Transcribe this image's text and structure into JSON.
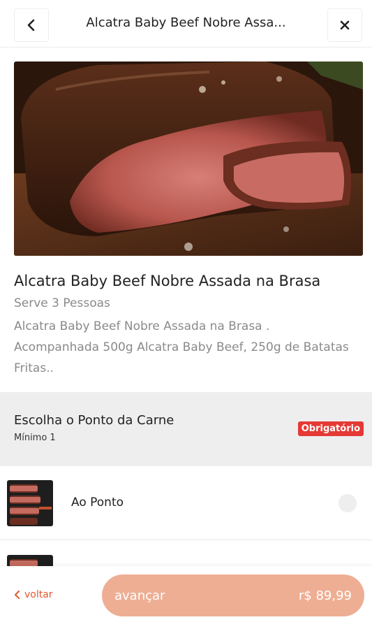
{
  "header": {
    "title": "Alcatra Baby Beef Nobre Assa...",
    "back_icon": "chevron-left-icon",
    "close_icon": "close-icon"
  },
  "product": {
    "name": "Alcatra Baby Beef Nobre Assada na Brasa",
    "serves": "Serve 3 Pessoas",
    "description": "Alcatra Baby Beef Nobre Assada na Brasa . Acompanhada 500g Alcatra Baby Beef, 250g de Batatas Fritas.."
  },
  "group": {
    "title": "Escolha o Ponto da Carne",
    "minimum": "Mínimo 1",
    "badge": "Obrigatório"
  },
  "options": [
    {
      "label": "Ao Ponto"
    },
    {
      "label": ""
    }
  ],
  "footer": {
    "back_label": "voltar",
    "next_label": "avançar",
    "price": "r$ 89,99"
  },
  "colors": {
    "accent": "#e4572e",
    "cta_bg": "#eeae94",
    "badge_bg": "#e53935",
    "group_bg": "#eeeeef"
  }
}
